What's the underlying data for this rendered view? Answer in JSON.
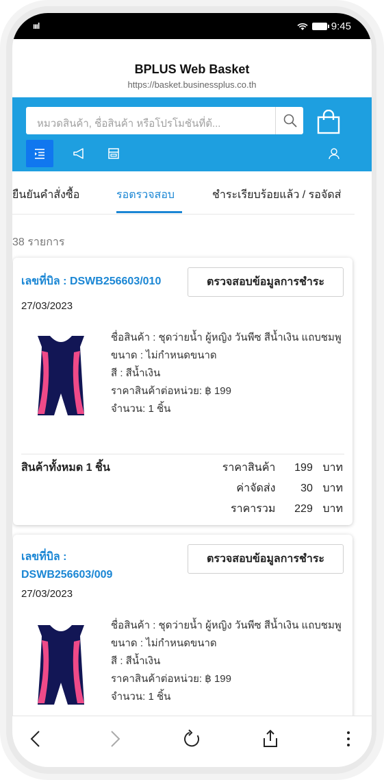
{
  "status": {
    "time": "9:45",
    "signal": "ıııl"
  },
  "browser": {
    "title": "BPLUS Web Basket",
    "url": "https://basket.businessplus.co.th"
  },
  "search": {
    "placeholder": "หมวดสินค้า, ชื่อสินค้า หรือโปรโมชันที่ต้..."
  },
  "tabs": [
    {
      "label": "ยืนยันคำสั่งซื้อ"
    },
    {
      "label": "รอตรวจสอบ"
    },
    {
      "label": "ชำระเรียบร้อยแล้ว / รอจัดส่"
    }
  ],
  "count_text": "38 รายการ",
  "orders": [
    {
      "bill": "เลขที่บิล : DSWB256603/010",
      "check_label": "ตรวจสอบข้อมูลการชำระ",
      "date": "27/03/2023",
      "product_name": "ชื่อสินค้า : ชุดว่ายน้ำ ผู้หญิง วันพีซ สีน้ำเงิน แถบชมพู",
      "size": "ขนาด : ไม่กำหนดขนาด",
      "color": "สี : สีน้ำเงิน",
      "unit_price": "ราคาสินค้าต่อหน่วย: ฿ 199",
      "qty": "จำนวน: 1 ชิ้น",
      "total_items": "สินค้าทั้งหมด 1 ชิ้น",
      "price_label": "ราคาสินค้า",
      "price_value": "199",
      "unit": "บาท",
      "shipping_label": "ค่าจัดส่ง",
      "shipping_value": "30",
      "sum_label": "ราคารวม",
      "sum_value": "229"
    },
    {
      "bill_line1": "เลขที่บิล :",
      "bill_line2": "DSWB256603/009",
      "check_label": "ตรวจสอบข้อมูลการชำระ",
      "date": "27/03/2023",
      "product_name": "ชื่อสินค้า : ชุดว่ายน้ำ ผู้หญิง วันพีซ สีน้ำเงิน แถบชมพู",
      "size": "ขนาด : ไม่กำหนดขนาด",
      "color": "สี : สีน้ำเงิน",
      "unit_price": "ราคาสินค้าต่อหน่วย: ฿ 199",
      "qty": "จำนวน: 1 ชิ้น"
    }
  ],
  "colors": {
    "brand_blue": "#1e9fe0",
    "accent": "#1a86d4",
    "active_tool": "#1077ef",
    "swimsuit_navy": "#121655",
    "swimsuit_pink": "#ef4a88"
  },
  "icons": [
    "back-icon",
    "forward-icon",
    "reload-icon",
    "share-icon",
    "more-icon",
    "search-icon",
    "shopping-bag-icon",
    "list-icon",
    "megaphone-icon",
    "store-icon",
    "user-icon"
  ]
}
